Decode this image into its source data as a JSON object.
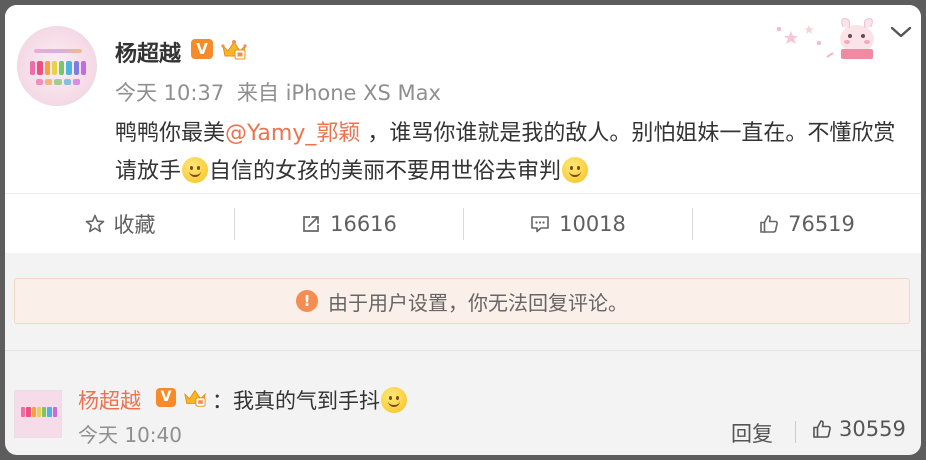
{
  "post": {
    "username": "杨超越",
    "verified_badge": "V",
    "member_icon": "crown-icon",
    "time": "今天 10:37",
    "source": "来自 iPhone XS Max",
    "text_before": "鸭鸭你最美",
    "mention": "@Yamy_郭颖",
    "text_mid": " ，谁骂你谁就是我的敌人。别怕姐妹一直在。不懂欣赏请放手",
    "text_mid2": "自信的女孩的美丽不要用世俗去审判",
    "emoji_name": "smile-emoji"
  },
  "actions": {
    "favorite_label": "收藏",
    "repost_count": "16616",
    "comment_count": "10018",
    "like_count": "76519"
  },
  "notice": {
    "text": "由于用户设置，你无法回复评论。"
  },
  "comment": {
    "username": "杨超越",
    "verified_badge": "V",
    "text": "：我真的气到手抖",
    "time": "今天 10:40",
    "reply_label": "回复",
    "like_count": "30559"
  },
  "colors": {
    "mention": "#eb7350",
    "badge": "#f78b2a",
    "notice_bg": "#fbefe9",
    "warn": "#f58d53"
  }
}
